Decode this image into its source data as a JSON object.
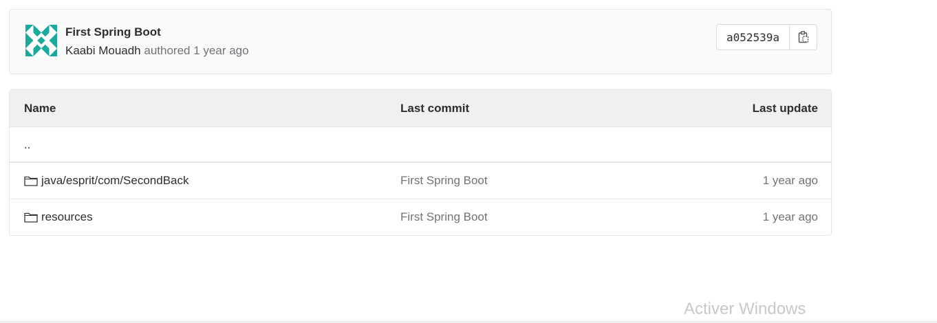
{
  "commit": {
    "title": "First Spring Boot",
    "author": "Kaabi Mouadh",
    "authored_text": "authored",
    "time": "1 year ago",
    "sha": "a052539a",
    "avatar_color": "#1aaa9b"
  },
  "table": {
    "headers": {
      "name": "Name",
      "last_commit": "Last commit",
      "last_update": "Last update"
    },
    "parent": "..",
    "rows": [
      {
        "name": "java/esprit/com/SecondBack",
        "icon": "folder-icon",
        "last_commit": "First Spring Boot",
        "last_update": "1 year ago"
      },
      {
        "name": "resources",
        "icon": "folder-icon",
        "last_commit": "First Spring Boot",
        "last_update": "1 year ago"
      }
    ]
  },
  "watermark": "Activer Windows"
}
